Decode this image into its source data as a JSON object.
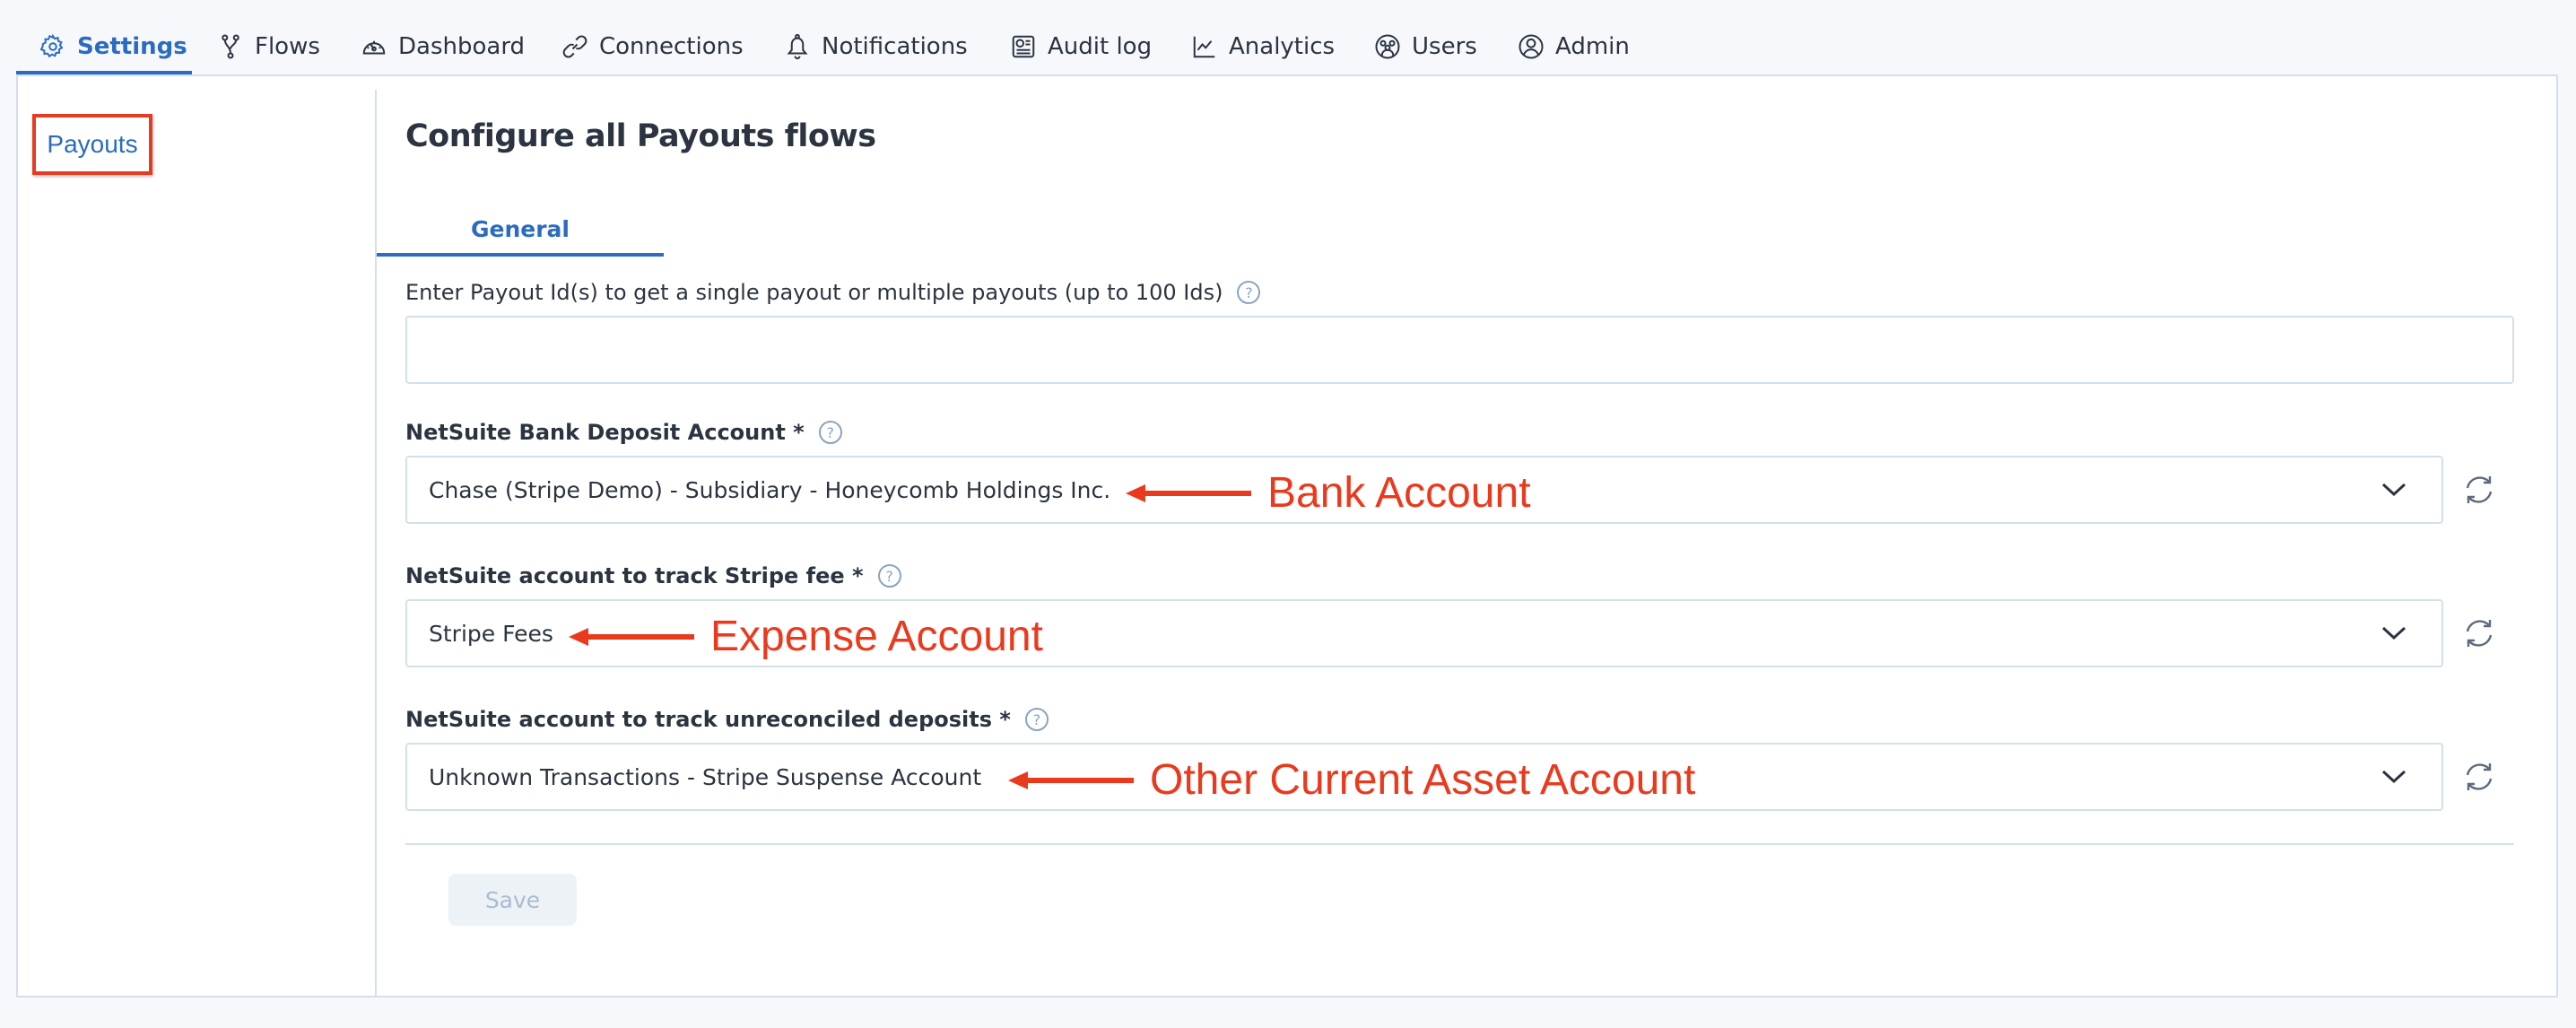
{
  "nav": {
    "tabs": [
      {
        "label": "Settings",
        "icon": "gear-icon",
        "active": true
      },
      {
        "label": "Flows",
        "icon": "flow-branch-icon"
      },
      {
        "label": "Dashboard",
        "icon": "speedometer-icon"
      },
      {
        "label": "Connections",
        "icon": "link-icon"
      },
      {
        "label": "Notifications",
        "icon": "bell-icon"
      },
      {
        "label": "Audit log",
        "icon": "audit-log-icon"
      },
      {
        "label": "Analytics",
        "icon": "line-chart-icon"
      },
      {
        "label": "Users",
        "icon": "users-icon"
      },
      {
        "label": "Admin",
        "icon": "user-circle-icon"
      }
    ]
  },
  "sidebar": {
    "items": [
      {
        "label": "Payouts",
        "selected": true
      }
    ]
  },
  "main": {
    "title": "Configure all Payouts flows",
    "tabs": [
      {
        "label": "General",
        "active": true
      }
    ],
    "fields": {
      "payout_ids": {
        "label": "Enter Payout Id(s) to get a single payout or multiple payouts (up to 100 Ids)",
        "value": "",
        "placeholder": ""
      },
      "bank_deposit_account": {
        "label": "NetSuite Bank Deposit Account *",
        "value": "Chase (Stripe Demo) - Subsidiary - Honeycomb Holdings Inc."
      },
      "stripe_fee_account": {
        "label": "NetSuite account to track Stripe fee *",
        "value": "Stripe Fees"
      },
      "unreconciled_account": {
        "label": "NetSuite account to track unreconciled deposits *",
        "value": "Unknown Transactions - Stripe Suspense Account"
      }
    },
    "help_glyph": "?",
    "save_label": "Save",
    "save_disabled": true
  },
  "annotations": {
    "bank": "Bank Account",
    "expense": "Expense Account",
    "asset": "Other Current Asset Account",
    "color": "#ea3a1e"
  },
  "colors": {
    "accent": "#2b6cbf",
    "border": "#d3e0ea",
    "background": "#f6f8fc",
    "annotation_box": "#e63b22"
  }
}
